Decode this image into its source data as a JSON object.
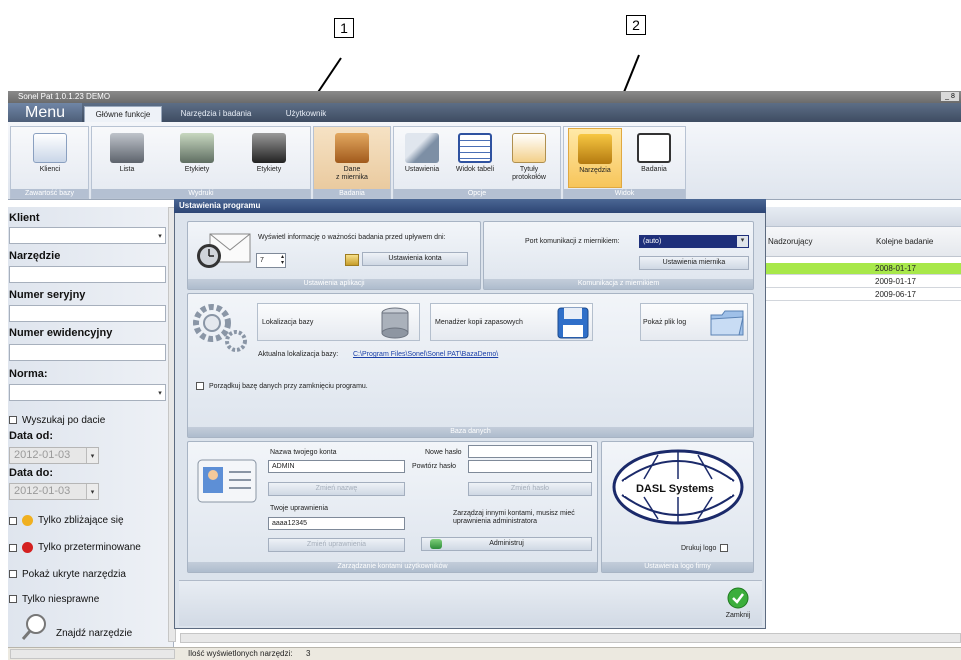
{
  "callouts": [
    "1",
    "2"
  ],
  "window": {
    "title": "Sonel Pat 1.0.1.23 DEMO",
    "controls": "_ 8"
  },
  "ribbon": {
    "menu_label": "Menu",
    "tabs": [
      {
        "label": "Główne funkcje"
      },
      {
        "label": "Narzędzia i badania"
      },
      {
        "label": "Użytkownik"
      }
    ],
    "groups": [
      {
        "label": "Zawartość bazy"
      },
      {
        "label": "Wydruki"
      },
      {
        "label": "Badania"
      },
      {
        "label": "Opcje"
      },
      {
        "label": "Widok"
      }
    ],
    "buttons": [
      {
        "label": "Klienci",
        "icon": "clients-card-icon"
      },
      {
        "label": "Lista",
        "icon": "printer-icon"
      },
      {
        "label": "Etykiety",
        "icon": "label-printer-icon"
      },
      {
        "label": "Etykiety",
        "icon": "label-printer-dark-icon"
      },
      {
        "label": "Dane\nz miernika",
        "icon": "meter-case-icon"
      },
      {
        "label": "Ustawienia",
        "icon": "tools-icon"
      },
      {
        "label": "Widok tabeli",
        "icon": "table-icon"
      },
      {
        "label": "Tytuły\nprotokołów",
        "icon": "document-icon"
      },
      {
        "label": "Narzędzia",
        "icon": "drill-icon"
      },
      {
        "label": "Badania",
        "icon": "checklist-icon"
      }
    ]
  },
  "filters": {
    "client_label": "Klient",
    "tool_label": "Narzędzie",
    "serial_label": "Numer seryjny",
    "inventory_label": "Numer ewidencyjny",
    "norm_label": "Norma:",
    "search_by_date": "Wyszukaj po dacie",
    "date_from_label": "Data od:",
    "date_from": "2012-01-03",
    "date_to_label": "Data do:",
    "date_to": "2012-01-03",
    "only_upcoming": "Tylko zbliżające się",
    "only_overdue": "Tylko przeterminowane",
    "show_hidden": "Pokaż ukryte narzędzia",
    "only_faulty": "Tylko niesprawne",
    "find_tool": "Znajdź narzędzie"
  },
  "grid": {
    "columns": [
      "Nadzorujący",
      "Kolejne badanie"
    ],
    "rows": [
      {
        "next": "2008-01-17",
        "highlight": true
      },
      {
        "next": "2009-01-17",
        "highlight": false
      },
      {
        "next": "2009-06-17",
        "highlight": false
      }
    ]
  },
  "dialog": {
    "title": "Ustawienia programu",
    "app_settings": {
      "info_text": "Wyświetl informację o ważności badania przed upływem dni:",
      "days_value": "7",
      "account_settings_button": "Ustawienia konta",
      "panel_label": "Ustawienia aplikacji"
    },
    "meter_comm": {
      "port_label": "Port komunikacji z miernikiem:",
      "port_value": "(auto)",
      "meter_settings_button": "Ustawienia miernika",
      "panel_label": "Komunikacja z miernikiem"
    },
    "database": {
      "location_button": "Lokalizacja bazy",
      "backup_button": "Menadżer kopii zapasowych",
      "log_button": "Pokaż plik log",
      "current_location_label": "Aktualna lokalizacja bazy:",
      "current_location_path": "C:\\Program Files\\Sonel\\Sonel PAT\\BazaDemo\\",
      "cleanup_checkbox": "Porządkuj bazę danych przy zamknięciu programu.",
      "panel_label": "Baza danych"
    },
    "accounts": {
      "account_name_label": "Nazwa twojego konta",
      "account_name_value": "ADMIN",
      "change_name_button": "Zmień nazwę",
      "new_password_label": "Nowe hasło",
      "repeat_password_label": "Powtórz hasło",
      "change_password_button": "Zmień hasło",
      "permissions_label": "Twoje uprawnienia",
      "permissions_value": "aaaa12345",
      "change_permissions_button": "Zmień uprawnienia",
      "admin_note": "Zarządzaj innymi kontami, musisz mieć uprawnienia administratora",
      "administer_button": "Administruj",
      "panel_label": "Zarządzanie kontami użytkowników"
    },
    "logo": {
      "logo_text": "DASL Systems",
      "print_logo": "Drukuj logo",
      "panel_label": "Ustawienia logo firmy"
    },
    "close_button": "Zamknij",
    "colors": {
      "title_bar": "#2d4574",
      "accent": "#3cae3c",
      "highlight_row": "#a8e84a"
    }
  },
  "status": {
    "text": "Ilość wyświetlonych narzędzi:",
    "count": "3"
  }
}
